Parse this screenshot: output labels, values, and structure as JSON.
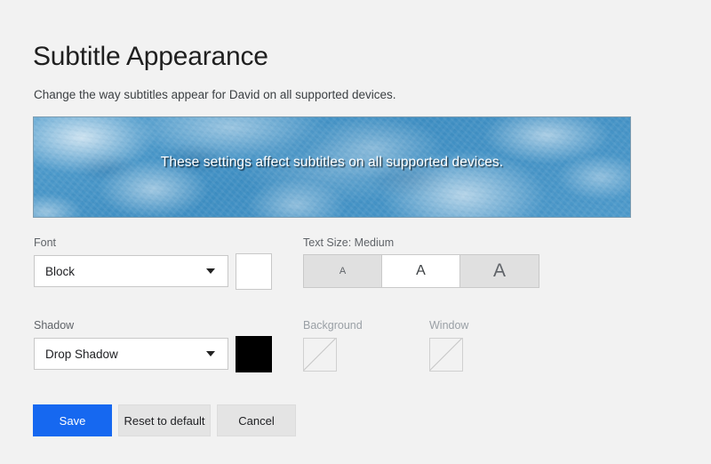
{
  "header": {
    "title": "Subtitle Appearance",
    "description": "Change the way subtitles appear for David on all supported devices."
  },
  "preview": {
    "caption": "These settings affect subtitles on all supported devices.",
    "sky_color": "#3e92c8",
    "caption_color": "#ffffff"
  },
  "controls": {
    "font": {
      "label": "Font",
      "value": "Block",
      "caret_icon": "chevron-down-icon",
      "color_value": "#ffffff"
    },
    "text_size": {
      "label": "Text Size: Medium",
      "selected": "Medium",
      "options": [
        {
          "label": "A",
          "size": "Small",
          "selected": false
        },
        {
          "label": "A",
          "size": "Medium",
          "selected": true
        },
        {
          "label": "A",
          "size": "Large",
          "selected": false
        }
      ]
    },
    "shadow": {
      "label": "Shadow",
      "value": "Drop Shadow",
      "caret_icon": "chevron-down-icon",
      "color_value": "#000000"
    },
    "background": {
      "label": "Background",
      "value": "None",
      "disabled": true,
      "swatch_icon": "no-color-slash-icon"
    },
    "window": {
      "label": "Window",
      "value": "None",
      "disabled": true,
      "swatch_icon": "no-color-slash-icon"
    }
  },
  "actions": {
    "save": "Save",
    "reset": "Reset to default",
    "cancel": "Cancel",
    "primary_color": "#1668f0"
  }
}
